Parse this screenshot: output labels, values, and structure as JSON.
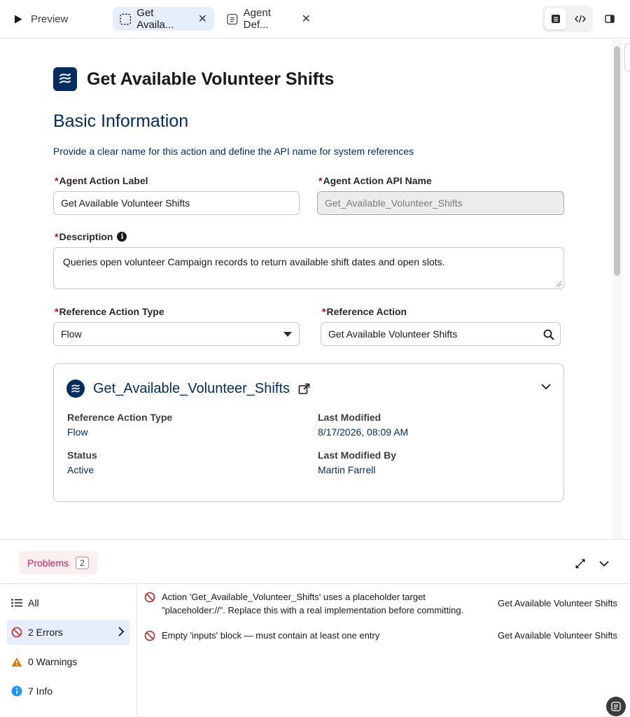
{
  "topbar": {
    "preview_label": "Preview",
    "tabs": [
      {
        "label": "Get Availa...",
        "active": true
      },
      {
        "label": "Agent Def...",
        "active": false
      }
    ]
  },
  "page": {
    "title": "Get Available Volunteer Shifts"
  },
  "basic_info": {
    "heading": "Basic Information",
    "subtitle": "Provide a clear name for this action and define the API name for system references",
    "label_field": {
      "label": "Agent Action Label",
      "value": "Get Available Volunteer Shifts"
    },
    "api_name_field": {
      "label": "Agent Action API Name",
      "value": "Get_Available_Volunteer_Shifts"
    },
    "description_field": {
      "label": "Description",
      "value": "Queries open volunteer Campaign records to return available shift dates and open slots."
    },
    "ref_type_field": {
      "label": "Reference Action Type",
      "value": "Flow"
    },
    "ref_action_field": {
      "label": "Reference Action",
      "value": "Get Available Volunteer Shifts"
    }
  },
  "reference_card": {
    "title": "Get_Available_Volunteer_Shifts",
    "ref_type_label": "Reference Action Type",
    "ref_type_value": "Flow",
    "last_modified_label": "Last Modified",
    "last_modified_value": "8/17/2026, 08:09 AM",
    "status_label": "Status",
    "status_value": "Active",
    "modified_by_label": "Last Modified By",
    "modified_by_value": "Martin Farrell"
  },
  "problems": {
    "tab_label": "Problems",
    "count": "2",
    "filters": [
      {
        "label": "All"
      },
      {
        "label": "2 Errors"
      },
      {
        "label": "0 Warnings"
      },
      {
        "label": "7 Info"
      }
    ],
    "issues": [
      {
        "line1": "Action 'Get_Available_Volunteer_Shifts' uses a placeholder target",
        "line2": "\"placeholder://\". Replace this with a real implementation before committing.",
        "source": "Get Available Volunteer Shifts"
      },
      {
        "line1": "Empty 'inputs' block — must contain at least one entry",
        "line2": "",
        "source": "Get Available Volunteer Shifts"
      }
    ]
  },
  "colors": {
    "brand_navy": "#032d60",
    "required": "#ba0517",
    "error": "#c23934",
    "warning": "#dd7a01",
    "info": "#1b96ff",
    "active_tab_bg": "#e6eefb",
    "problems_tab_bg": "#fdeef0"
  }
}
